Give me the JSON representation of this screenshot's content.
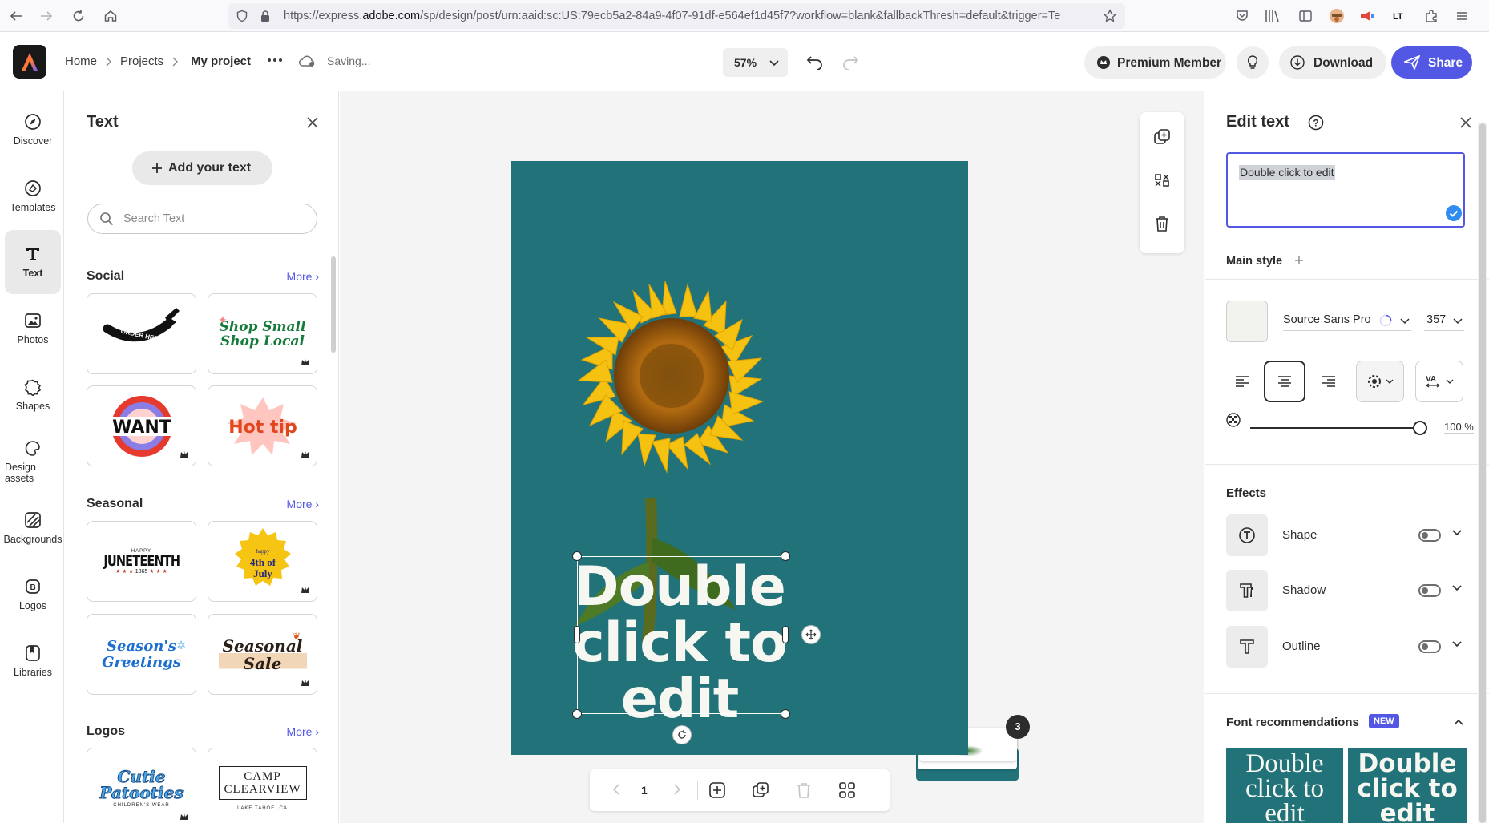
{
  "browser": {
    "url_prefix": "https://express.",
    "url_domain": "adobe.com",
    "url_rest": "/sp/design/post/urn:aaid:sc:US:79ecb5a2-84a9-4f07-91df-e564ef1d45f7?workflow=blank&fallbackThresh=default&trigger=Te"
  },
  "header": {
    "breadcrumbs": [
      "Home",
      "Projects",
      "My project"
    ],
    "save_status": "Saving...",
    "zoom": "57%",
    "premium_label": "Premium Member",
    "download_label": "Download",
    "share_label": "Share",
    "accent": "#5258e4"
  },
  "rail": {
    "items": [
      {
        "label": "Discover",
        "icon": "compass-icon"
      },
      {
        "label": "Templates",
        "icon": "templates-icon"
      },
      {
        "label": "Text",
        "icon": "text-icon",
        "active": true
      },
      {
        "label": "Photos",
        "icon": "photos-icon"
      },
      {
        "label": "Shapes",
        "icon": "shapes-icon"
      },
      {
        "label": "Design assets",
        "icon": "design-assets-icon"
      },
      {
        "label": "Backgrounds",
        "icon": "backgrounds-icon"
      },
      {
        "label": "Logos",
        "icon": "logos-icon"
      },
      {
        "label": "Libraries",
        "icon": "libraries-icon"
      }
    ]
  },
  "textpanel": {
    "title": "Text",
    "add_button": "Add your text",
    "search_placeholder": "Search Text",
    "more_label": "More",
    "sections": [
      {
        "title": "Social",
        "cards": [
          "ORDER HERE",
          "Shop Small Shop Local",
          "WANT",
          "Hot tip"
        ]
      },
      {
        "title": "Seasonal",
        "cards": [
          "JUNETEENTH",
          "4th of July",
          "Season's Greetings",
          "Seasonal Sale"
        ]
      },
      {
        "title": "Logos",
        "cards": [
          "Cutie Patooties",
          "CAMP CLEARVIEW"
        ]
      }
    ],
    "card_small": {
      "juneteenth_top": "HAPPY",
      "juneteenth_bottom": "1865",
      "july_top": "happy",
      "camp_sub": "LAKE TAHOE, CA",
      "cutie_sub": "CHILDREN'S WEAR"
    }
  },
  "canvas": {
    "artboard_color": "#227279",
    "text_line1": "Double",
    "text_line2": "click to",
    "text_line3": "edit",
    "page_number": "1",
    "page_count_badge": "3"
  },
  "editpanel": {
    "title": "Edit text",
    "text_value": "Double click to edit",
    "main_style": "Main style",
    "font_family": "Source Sans Pro",
    "font_size": "357",
    "opacity": "100 %",
    "opacity_value": 100,
    "effects_title": "Effects",
    "effects": [
      {
        "label": "Shape",
        "icon": "shape-text-icon",
        "enabled": false
      },
      {
        "label": "Shadow",
        "icon": "shadow-text-icon",
        "enabled": false
      },
      {
        "label": "Outline",
        "icon": "outline-text-icon",
        "enabled": false
      }
    ],
    "font_rec_title": "Font recommendations",
    "new_badge": "NEW",
    "rec1": "Double click to edit",
    "rec2": "Double click to edit"
  }
}
